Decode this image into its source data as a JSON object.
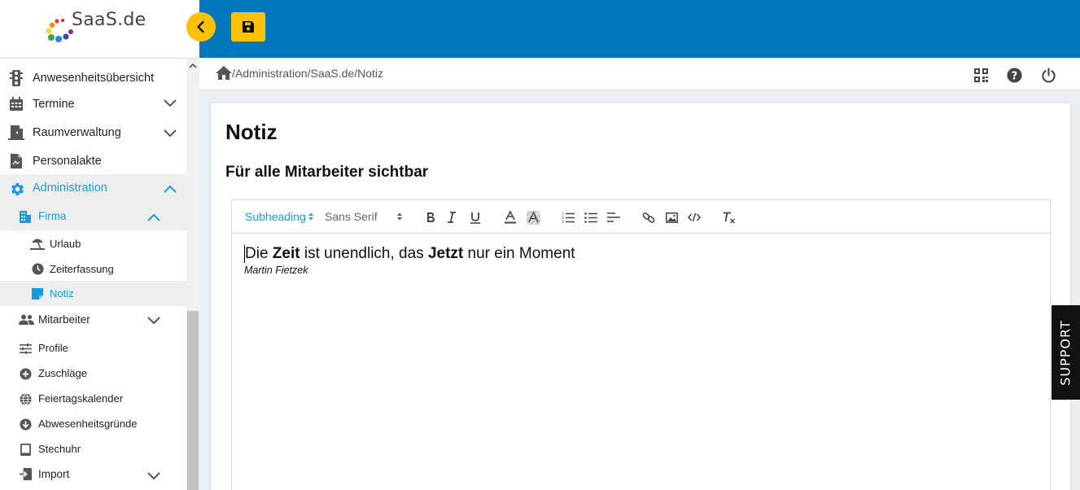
{
  "app": {
    "logo_text": "SaaS.de"
  },
  "colors": {
    "header_blue": "#0277bd",
    "accent_yellow": "#ffc107",
    "active_blue": "#1a9be0"
  },
  "sidebar": {
    "items": [
      {
        "label": "Anwesenheitsübersicht",
        "icon": "traffic-light-icon"
      },
      {
        "label": "Termine",
        "icon": "calendar-icon"
      },
      {
        "label": "Raumverwaltung",
        "icon": "door-icon"
      },
      {
        "label": "Personalakte",
        "icon": "file-icon"
      },
      {
        "label": "Administration",
        "icon": "gear-icon"
      },
      {
        "label": "Firma",
        "icon": "building-icon"
      },
      {
        "label": "Urlaub",
        "icon": "beach-umbrella-icon"
      },
      {
        "label": "Zeiterfassung",
        "icon": "clock-icon"
      },
      {
        "label": "Notiz",
        "icon": "note-icon"
      },
      {
        "label": "Mitarbeiter",
        "icon": "people-icon"
      },
      {
        "label": "Profile",
        "icon": "sliders-icon"
      },
      {
        "label": "Zuschläge",
        "icon": "plus-circle-icon"
      },
      {
        "label": "Feiertagskalender",
        "icon": "globe-icon"
      },
      {
        "label": "Abwesenheitsgründe",
        "icon": "arrow-down-circle-icon"
      },
      {
        "label": "Stechuhr",
        "icon": "tablet-icon"
      },
      {
        "label": "Import",
        "icon": "import-icon"
      }
    ]
  },
  "breadcrumb": {
    "path": "/Administration/SaaS.de/Notiz"
  },
  "page": {
    "title": "Notiz",
    "subtitle": "Für alle Mitarbeiter sichtbar"
  },
  "editor": {
    "format_select": "Subheading",
    "font_select": "Sans Serif",
    "text": {
      "p1": "Die ",
      "b1": "Zeit",
      "p2": " ist unendlich, das ",
      "b2": "Jetzt",
      "p3": " nur ein Moment",
      "author": "Martin Fietzek"
    }
  },
  "support": {
    "label": "SUPPORT"
  }
}
